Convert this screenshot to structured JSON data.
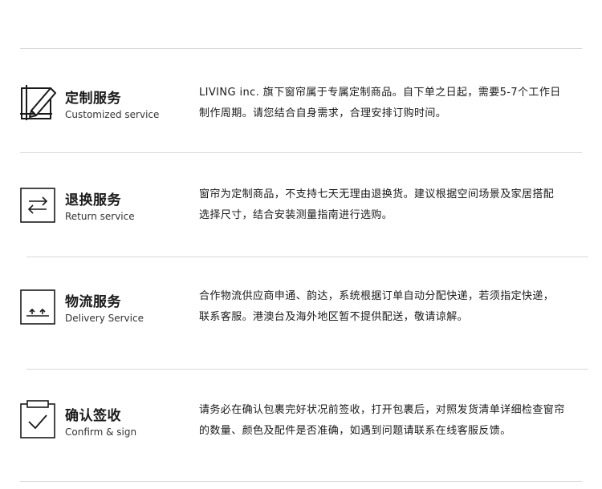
{
  "sections": [
    {
      "icon": "pencil-square-icon",
      "title": "定制服务",
      "subtitle": "Customized service",
      "lines": [
        "LIVING inc. 旗下窗帘属于专属定制商品。自下单之日起，需要5-7个工作日",
        "制作周期。请您结合自身需求，合理安排订购时间。"
      ]
    },
    {
      "icon": "exchange-arrows-icon",
      "title": "退换服务",
      "subtitle": "Return service",
      "lines": [
        "窗帘为定制商品，不支持七天无理由退换货。建议根据空间场景及家居搭配",
        "选择尺寸，结合安装测量指南进行选购。"
      ]
    },
    {
      "icon": "delivery-box-icon",
      "title": "物流服务",
      "subtitle": "Delivery Service",
      "lines": [
        "合作物流供应商申通、韵达，系统根据订单自动分配快递，若须指定快递，",
        "联系客服。港澳台及海外地区暂不提供配送，敬请谅解。"
      ]
    },
    {
      "icon": "clipboard-check-icon",
      "title": "确认签收",
      "subtitle": "Confirm & sign",
      "lines": [
        "请务必在确认包裹完好状况前签收，打开包裹后，对照发货清单详细检查窗帘",
        "的数量、颜色及配件是否准确，如遇到问题请联系在线客服反馈。"
      ]
    }
  ]
}
